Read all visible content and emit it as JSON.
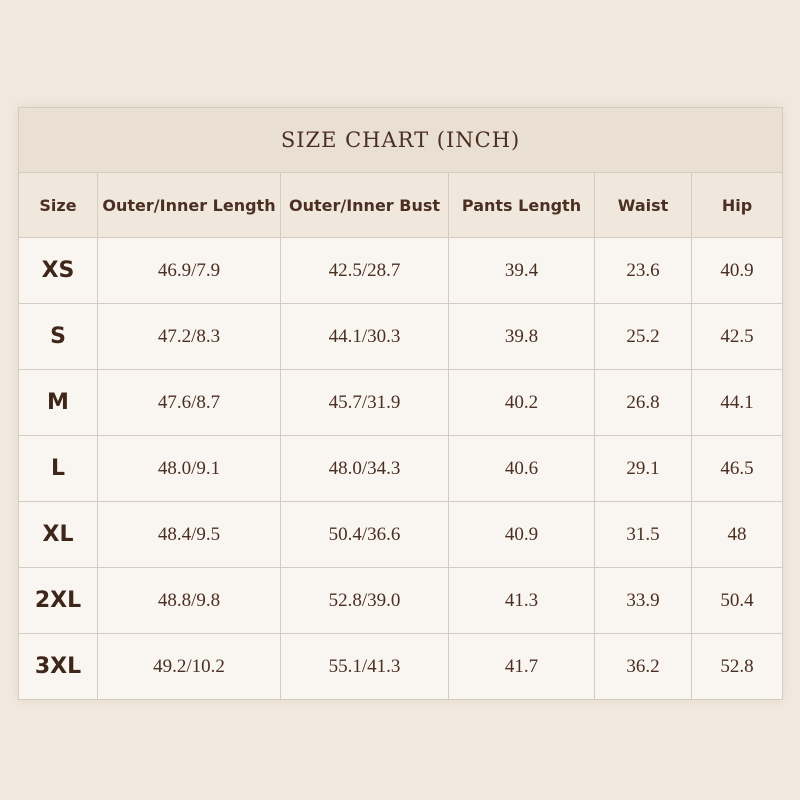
{
  "title": "SIZE CHART (INCH)",
  "headers": [
    "Size",
    "Outer/Inner Length",
    "Outer/Inner Bust",
    "Pants Length",
    "Waist",
    "Hip"
  ],
  "rows": [
    [
      "XS",
      "46.9/7.9",
      "42.5/28.7",
      "39.4",
      "23.6",
      "40.9"
    ],
    [
      "S",
      "47.2/8.3",
      "44.1/30.3",
      "39.8",
      "25.2",
      "42.5"
    ],
    [
      "M",
      "47.6/8.7",
      "45.7/31.9",
      "40.2",
      "26.8",
      "44.1"
    ],
    [
      "L",
      "48.0/9.1",
      "48.0/34.3",
      "40.6",
      "29.1",
      "46.5"
    ],
    [
      "XL",
      "48.4/9.5",
      "50.4/36.6",
      "40.9",
      "31.5",
      "48"
    ],
    [
      "2XL",
      "48.8/9.8",
      "52.8/39.0",
      "41.3",
      "33.9",
      "50.4"
    ],
    [
      "3XL",
      "49.2/10.2",
      "55.1/41.3",
      "41.7",
      "36.2",
      "52.8"
    ]
  ],
  "colors": {
    "background": "#f1e9de",
    "title_band": "#eadfd3",
    "header_band": "#f1e8dd",
    "cell": "#f9f5f0",
    "text": "#4a2f22",
    "border": "#d6cbc0"
  }
}
